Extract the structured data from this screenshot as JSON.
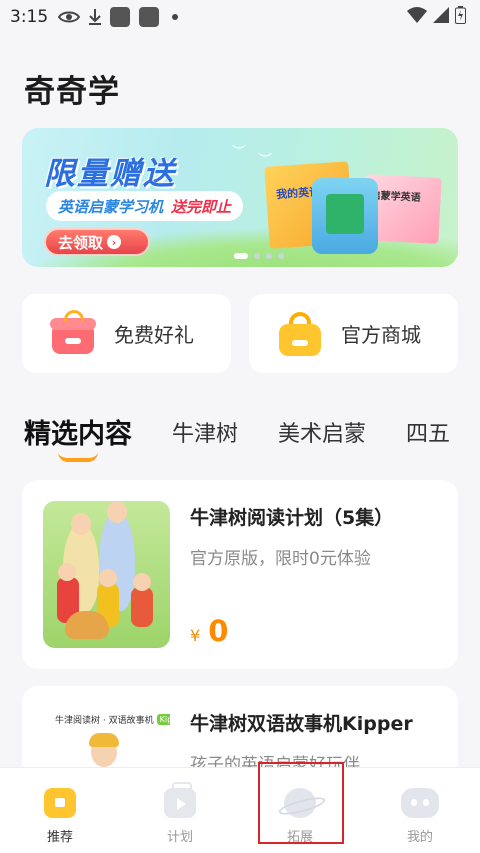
{
  "status_bar": {
    "time": "3:15",
    "icons": [
      "eye-icon",
      "download-icon",
      "app-square-icon",
      "app-square-icon",
      "dot-icon",
      "wifi-icon",
      "signal-icon",
      "battery-icon"
    ]
  },
  "header": {
    "title": "奇奇学"
  },
  "banner": {
    "headline": "限量赠送",
    "subtitle_a": "英语启蒙学习机",
    "subtitle_b": "送完即止",
    "cta_label": "去领取",
    "product_text_1": "我的英语",
    "product_text_2": "启蒙学英语",
    "slide_count": 4,
    "active_slide": 1
  },
  "quick_links": [
    {
      "label": "免费好礼",
      "icon": "gift-icon"
    },
    {
      "label": "官方商城",
      "icon": "shopping-bag-icon"
    }
  ],
  "tabs": [
    {
      "label": "精选内容",
      "active": true
    },
    {
      "label": "牛津树",
      "active": false
    },
    {
      "label": "美术启蒙",
      "active": false
    },
    {
      "label": "四五",
      "active": false
    }
  ],
  "content": [
    {
      "title": "牛津树阅读计划（5集）",
      "desc": "官方原版，限时0元体验",
      "price_symbol": "¥",
      "price": "0"
    },
    {
      "title": "牛津树双语故事机Kipper",
      "desc": "孩子的英语启蒙好玩伴",
      "thumb_caption": "牛津阅读树 · 双语故事机",
      "thumb_tag": "Kipper"
    }
  ],
  "bottom_nav": [
    {
      "label": "推荐",
      "icon": "home-star-icon",
      "active": true
    },
    {
      "label": "计划",
      "icon": "tv-play-icon",
      "active": false
    },
    {
      "label": "拓展",
      "icon": "planet-icon",
      "active": false
    },
    {
      "label": "我的",
      "icon": "robot-face-icon",
      "active": false
    }
  ],
  "colors": {
    "accent": "#ff9f1a",
    "price": "#ff8a00",
    "highlight_box": "#d6262c"
  }
}
